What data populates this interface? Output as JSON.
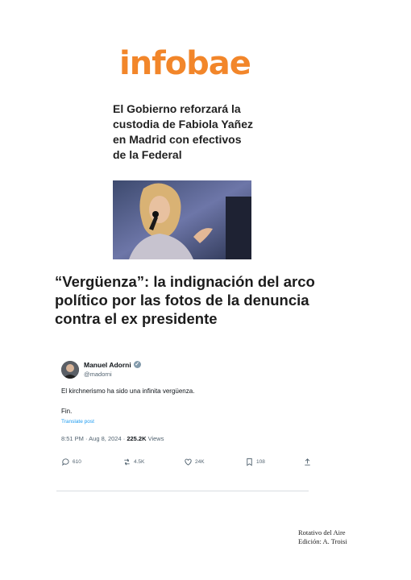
{
  "logo": {
    "text": "infobae",
    "color": "#f2862a"
  },
  "headline1": "El Gobierno reforzará la custodia de Fabiola Yañez en Madrid con efectivos de la Federal",
  "photo": {
    "icon": "photo-of-woman-speaking-at-microphone"
  },
  "headline2": "“Vergüenza”: la indignación del arco político por las fotos de la denuncia contra el ex presidente",
  "tweet": {
    "name": "Manuel Adorni",
    "handle": "@madorni",
    "text": "El kirchnerismo ha sido una infinita vergüenza.",
    "text2": "Fin.",
    "translate": "Translate post",
    "time": "8:51 PM · Aug 8, 2024 · ",
    "views_count": "225.2K",
    "views_label": " Views",
    "replies": "610",
    "reposts": "4.5K",
    "likes": "24K",
    "bookmarks": "108"
  },
  "credit": {
    "line1": "Rotativo del Aire",
    "line2": "Edición: A. Troisi"
  }
}
